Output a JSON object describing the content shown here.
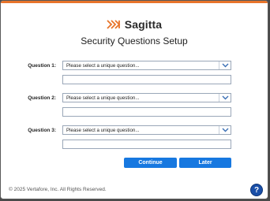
{
  "brand": {
    "name": "Sagitta",
    "accent": "#e8742a",
    "logo_color": "#2b2b2b"
  },
  "title": "Security Questions Setup",
  "questions": [
    {
      "label": "Question 1:",
      "placeholder": "Please select a unique question...",
      "answer": ""
    },
    {
      "label": "Question 2:",
      "placeholder": "Please select a unique question...",
      "answer": ""
    },
    {
      "label": "Question 3:",
      "placeholder": "Please select a unique question...",
      "answer": ""
    }
  ],
  "buttons": {
    "continue_label": "Continue",
    "later_label": "Later",
    "color": "#1778e0"
  },
  "footer": "© 2025 Vertafore, Inc. All Rights Reserved.",
  "help_icon": {
    "glyph": "?",
    "name": "help-icon"
  },
  "dropdown_icon": "chevron-down-icon"
}
